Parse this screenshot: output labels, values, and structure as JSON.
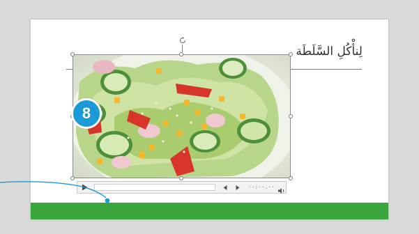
{
  "slide": {
    "title": "لِنأْكُلِ السَّلَطَة"
  },
  "badge": {
    "number": "8"
  },
  "media_bar": {
    "time": "··:··.··"
  },
  "colors": {
    "background": "#d9d9d9",
    "accent_green": "#3aa63d",
    "badge_blue": "#1a9ad6",
    "callout_line": "#1a9ad6"
  }
}
